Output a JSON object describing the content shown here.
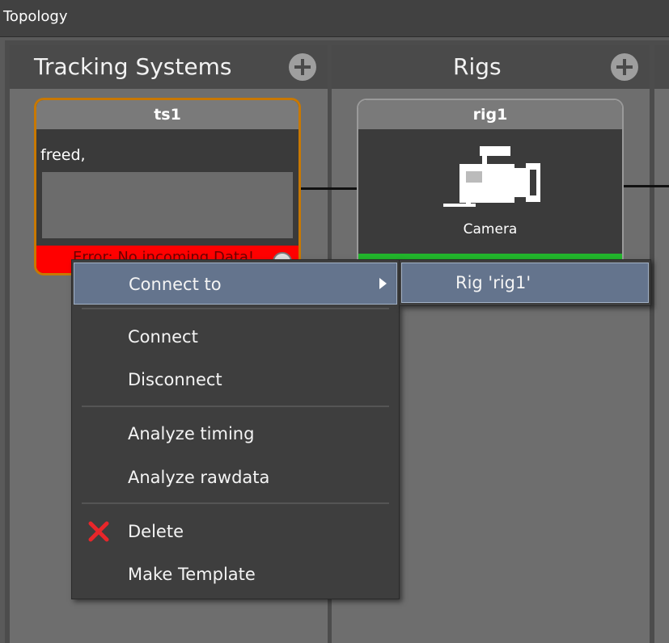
{
  "window": {
    "title": "Topology"
  },
  "columns": {
    "tracking_systems": {
      "title": "Tracking Systems"
    },
    "rigs": {
      "title": "Rigs"
    }
  },
  "nodes": {
    "ts1": {
      "name": "ts1",
      "description": "freed,",
      "error": "Error: No incoming Data!"
    },
    "rig1": {
      "name": "rig1",
      "type_label": "Camera",
      "icon": "video-camera-icon"
    }
  },
  "context_menu": {
    "connect_to": "Connect to",
    "connect": "Connect",
    "disconnect": "Disconnect",
    "analyze_timing": "Analyze timing",
    "analyze_rawdata": "Analyze rawdata",
    "delete": "Delete",
    "make_template": "Make Template"
  },
  "submenu": {
    "rig_option": "Rig 'rig1'"
  },
  "colors": {
    "selected_border": "#c87800",
    "error": "#ff0000",
    "ok_status": "#22b52c",
    "menu_highlight": "#64748d",
    "delete_icon": "#e8262a"
  }
}
